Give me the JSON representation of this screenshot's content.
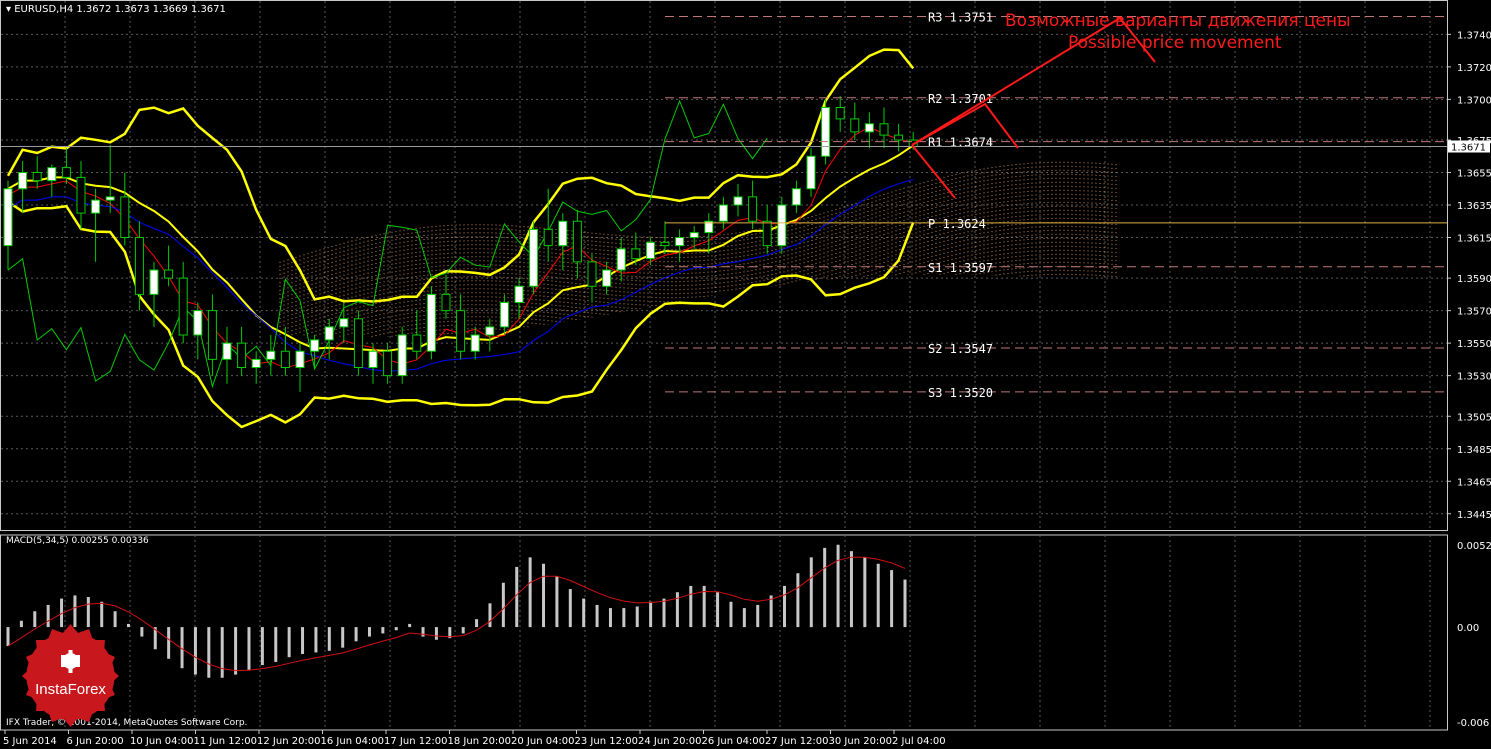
{
  "header": {
    "symbol_line": "EURUSD,H4  1.3672 1.3673 1.3669 1.3671"
  },
  "macd": {
    "label": "MACD(5,34,5) 0.00255 0.00336",
    "ticks": [
      "0.0052",
      "0.00",
      "-0.006"
    ]
  },
  "copyright": "IFX Trader, © 2001-2014, MetaQuotes Software Corp.",
  "logo": {
    "text": "InstaForex"
  },
  "colors": {
    "background": "#000000",
    "grid": "#5a5a5a",
    "bull_candle": "#ffffff",
    "bear_candle": "#000000",
    "bollinger": "#ffff00",
    "tenkan": "#ff0000",
    "kijun": "#0000ff",
    "chikou": "#00cc00",
    "kumo": "#d08a50",
    "pivot_line": "#e0b040",
    "levels": "#c07878",
    "annotation": "#ff1a1a",
    "macd_hist": "#c8c8c8",
    "macd_signal": "#d01010",
    "logo": "#c8181e"
  },
  "annotation": {
    "ru": "Возможные варианты движения цены",
    "en": "Possible price movement"
  },
  "current_price": "1.3671",
  "chart_data": {
    "type": "candlestick",
    "symbol": "EURUSD",
    "timeframe": "H4",
    "ohlc_last": {
      "open": 1.3672,
      "high": 1.3673,
      "low": 1.3669,
      "close": 1.3671
    },
    "ylim": [
      1.3435,
      1.3755
    ],
    "y_ticks": [
      "1.3740",
      "1.3720",
      "1.3700",
      "1.3675",
      "1.3655",
      "1.3635",
      "1.3615",
      "1.3590",
      "1.3570",
      "1.3550",
      "1.3530",
      "1.3505",
      "1.3485",
      "1.3465",
      "1.3445"
    ],
    "x_ticks": [
      "5 Jun 2014",
      "6 Jun 20:00",
      "10 Jun 04:00",
      "11 Jun 12:00",
      "12 Jun 20:00",
      "16 Jun 04:00",
      "17 Jun 12:00",
      "18 Jun 20:00",
      "20 Jun 04:00",
      "23 Jun 12:00",
      "24 Jun 20:00",
      "26 Jun 04:00",
      "27 Jun 12:00",
      "30 Jun 20:00",
      "2 Jul 04:00"
    ],
    "levels": [
      {
        "name": "R3",
        "label": "R3  1.3751",
        "value": 1.3751,
        "color": "#c07878"
      },
      {
        "name": "R2",
        "label": "R2  1.3701",
        "value": 1.3701,
        "color": "#c07878"
      },
      {
        "name": "R1",
        "label": "R1  1.3674",
        "value": 1.3674,
        "color": "#c07878"
      },
      {
        "name": "P",
        "label": "P  1.3624",
        "value": 1.3624,
        "color": "#e0b040"
      },
      {
        "name": "S1",
        "label": "S1  1.3597",
        "value": 1.3597,
        "color": "#c07878"
      },
      {
        "name": "S2",
        "label": "S2  1.3547",
        "value": 1.3547,
        "color": "#c07878"
      },
      {
        "name": "S3",
        "label": "S3  1.3520",
        "value": 1.352,
        "color": "#c07878"
      }
    ],
    "candles": [
      [
        1.361,
        1.365,
        1.3595,
        1.3645
      ],
      [
        1.3645,
        1.3662,
        1.363,
        1.3655
      ],
      [
        1.3655,
        1.3665,
        1.3645,
        1.365
      ],
      [
        1.365,
        1.366,
        1.364,
        1.3658
      ],
      [
        1.3658,
        1.367,
        1.3648,
        1.3652
      ],
      [
        1.3652,
        1.3662,
        1.362,
        1.363
      ],
      [
        1.363,
        1.3645,
        1.36,
        1.3638
      ],
      [
        1.3638,
        1.3672,
        1.363,
        1.364
      ],
      [
        1.364,
        1.3655,
        1.361,
        1.3615
      ],
      [
        1.3615,
        1.3625,
        1.357,
        1.358
      ],
      [
        1.358,
        1.36,
        1.356,
        1.3595
      ],
      [
        1.3595,
        1.361,
        1.3585,
        1.359
      ],
      [
        1.359,
        1.36,
        1.355,
        1.3555
      ],
      [
        1.3555,
        1.3575,
        1.354,
        1.357
      ],
      [
        1.357,
        1.358,
        1.353,
        1.354
      ],
      [
        1.354,
        1.356,
        1.3525,
        1.355
      ],
      [
        1.355,
        1.356,
        1.353,
        1.3535
      ],
      [
        1.3535,
        1.3545,
        1.3525,
        1.354
      ],
      [
        1.354,
        1.3555,
        1.353,
        1.3545
      ],
      [
        1.3545,
        1.356,
        1.353,
        1.3535
      ],
      [
        1.3535,
        1.355,
        1.352,
        1.3545
      ],
      [
        1.3545,
        1.3555,
        1.3535,
        1.3552
      ],
      [
        1.3552,
        1.3565,
        1.354,
        1.356
      ],
      [
        1.356,
        1.3575,
        1.355,
        1.3565
      ],
      [
        1.3565,
        1.357,
        1.353,
        1.3535
      ],
      [
        1.3535,
        1.355,
        1.3525,
        1.3545
      ],
      [
        1.3545,
        1.355,
        1.3525,
        1.353
      ],
      [
        1.353,
        1.356,
        1.3525,
        1.3555
      ],
      [
        1.3555,
        1.357,
        1.354,
        1.3545
      ],
      [
        1.3545,
        1.3585,
        1.354,
        1.358
      ],
      [
        1.358,
        1.3592,
        1.3565,
        1.357
      ],
      [
        1.357,
        1.358,
        1.354,
        1.3545
      ],
      [
        1.3545,
        1.356,
        1.354,
        1.3555
      ],
      [
        1.3555,
        1.3565,
        1.3545,
        1.356
      ],
      [
        1.356,
        1.358,
        1.3555,
        1.3575
      ],
      [
        1.3575,
        1.359,
        1.3565,
        1.3585
      ],
      [
        1.3585,
        1.3625,
        1.358,
        1.362
      ],
      [
        1.362,
        1.3645,
        1.36,
        1.361
      ],
      [
        1.361,
        1.363,
        1.3595,
        1.3625
      ],
      [
        1.3625,
        1.3632,
        1.359,
        1.36
      ],
      [
        1.36,
        1.3605,
        1.3575,
        1.3585
      ],
      [
        1.3585,
        1.36,
        1.358,
        1.3595
      ],
      [
        1.3595,
        1.3615,
        1.3588,
        1.3608
      ],
      [
        1.3608,
        1.3618,
        1.3598,
        1.3602
      ],
      [
        1.3602,
        1.3615,
        1.3598,
        1.3612
      ],
      [
        1.3612,
        1.3625,
        1.3605,
        1.361
      ],
      [
        1.361,
        1.362,
        1.36,
        1.3615
      ],
      [
        1.3615,
        1.3622,
        1.3608,
        1.3618
      ],
      [
        1.3618,
        1.363,
        1.3605,
        1.3625
      ],
      [
        1.3625,
        1.364,
        1.362,
        1.3635
      ],
      [
        1.3635,
        1.3648,
        1.3628,
        1.364
      ],
      [
        1.364,
        1.365,
        1.362,
        1.3625
      ],
      [
        1.3625,
        1.3635,
        1.3605,
        1.361
      ],
      [
        1.361,
        1.364,
        1.3605,
        1.3635
      ],
      [
        1.3635,
        1.365,
        1.363,
        1.3645
      ],
      [
        1.3645,
        1.367,
        1.364,
        1.3665
      ],
      [
        1.3665,
        1.37,
        1.366,
        1.3695
      ],
      [
        1.3695,
        1.3702,
        1.368,
        1.3688
      ],
      [
        1.3688,
        1.3698,
        1.3675,
        1.368
      ],
      [
        1.368,
        1.3692,
        1.367,
        1.3685
      ],
      [
        1.3685,
        1.3695,
        1.367,
        1.3678
      ],
      [
        1.3678,
        1.3685,
        1.3668,
        1.3675
      ],
      [
        1.3675,
        1.368,
        1.3669,
        1.3671
      ]
    ],
    "macd_hist": [
      -0.0012,
      0.0004,
      0.001,
      0.0014,
      0.0018,
      0.002,
      0.0019,
      0.0016,
      0.001,
      0.0002,
      -0.0006,
      -0.0014,
      -0.002,
      -0.0026,
      -0.003,
      -0.0032,
      -0.0032,
      -0.003,
      -0.0027,
      -0.0024,
      -0.0022,
      -0.0019,
      -0.0017,
      -0.0016,
      -0.0015,
      -0.0013,
      -0.0009,
      -0.0006,
      -0.0004,
      -0.0002,
      0.0002,
      -0.0006,
      -0.0008,
      -0.0007,
      -0.0004,
      0.0005,
      0.0015,
      0.0028,
      0.0038,
      0.0044,
      0.004,
      0.0032,
      0.0024,
      0.0018,
      0.0014,
      0.0012,
      0.0012,
      0.0013,
      0.0016,
      0.0018,
      0.0022,
      0.0026,
      0.0026,
      0.0022,
      0.0016,
      0.0012,
      0.0014,
      0.002,
      0.0026,
      0.0034,
      0.0044,
      0.005,
      0.0052,
      0.0048,
      0.0044,
      0.004,
      0.0036,
      0.003
    ]
  }
}
